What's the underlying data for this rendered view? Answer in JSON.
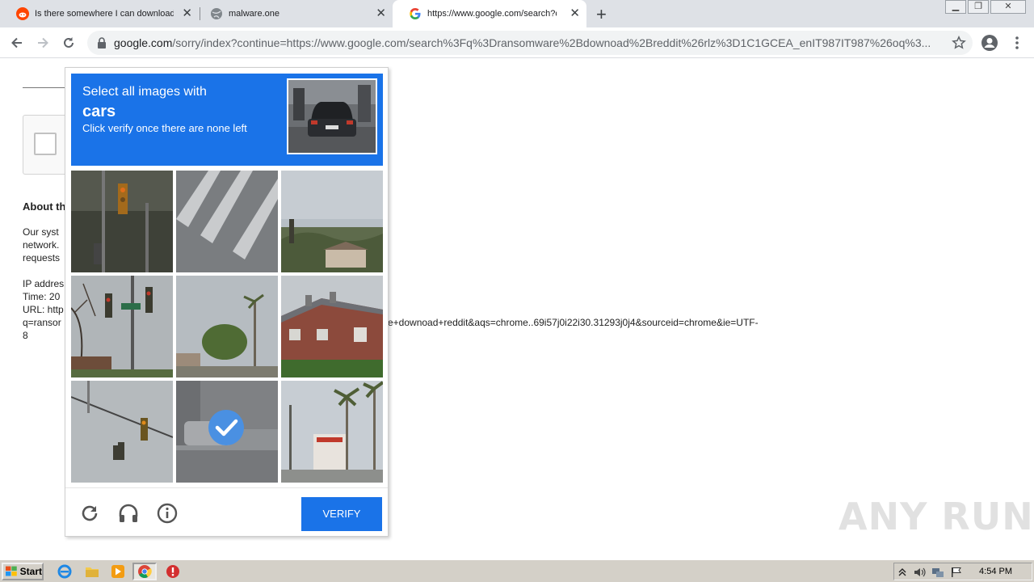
{
  "browser": {
    "tabs": [
      {
        "title": "Is there somewhere I can download",
        "favicon": "reddit-icon"
      },
      {
        "title": "malware.one",
        "favicon": "globe-icon"
      },
      {
        "title": "https://www.google.com/search?q=",
        "favicon": "google-icon"
      }
    ],
    "tab_close": "✕",
    "new_tab": "+",
    "url_host": "google.com",
    "url_rest": "/sorry/index?continue=https://www.google.com/search%3Fq%3Dransomware%2Bdownoad%2Breddit%26rlz%3D1C1GCEA_enIT987IT987%26oq%3..."
  },
  "page": {
    "about_heading": "About th",
    "about_lines": [
      "Our syst",
      "network.",
      "requests"
    ],
    "ip_line": "IP addres",
    "time_line": "Time: 20",
    "url_line": "URL: http",
    "query_line_left": "q=ransor",
    "query_line_right": "e+downoad+reddit&aqs=chrome..69i57j0i22i30.31293j0j4&sourceid=chrome&ie=UTF-",
    "query_line_end": "8"
  },
  "captcha": {
    "select_line": "Select all images with",
    "target": "cars",
    "instruction": "Click verify once there are none left",
    "verify_label": "VERIFY",
    "tiles": [
      {
        "subject": "traffic light night",
        "selected": false
      },
      {
        "subject": "crosswalk",
        "selected": false
      },
      {
        "subject": "hillside houses",
        "selected": false
      },
      {
        "subject": "traffic lights on pole",
        "selected": false
      },
      {
        "subject": "palm tree street",
        "selected": false
      },
      {
        "subject": "house",
        "selected": false
      },
      {
        "subject": "traffic lights",
        "selected": false
      },
      {
        "subject": "street car",
        "selected": true
      },
      {
        "subject": "palm trees",
        "selected": false
      }
    ],
    "footer_icons": [
      "reload-icon",
      "audio-headphones-icon",
      "info-icon"
    ],
    "colors": {
      "accent": "#1a73e8"
    }
  },
  "watermark": "ANY RUN",
  "taskbar": {
    "start_label": "Start",
    "apps": [
      "ie-icon",
      "explorer-folder-icon",
      "media-player-icon",
      "chrome-icon",
      "stop-icon"
    ],
    "clock": "4:54 PM"
  }
}
